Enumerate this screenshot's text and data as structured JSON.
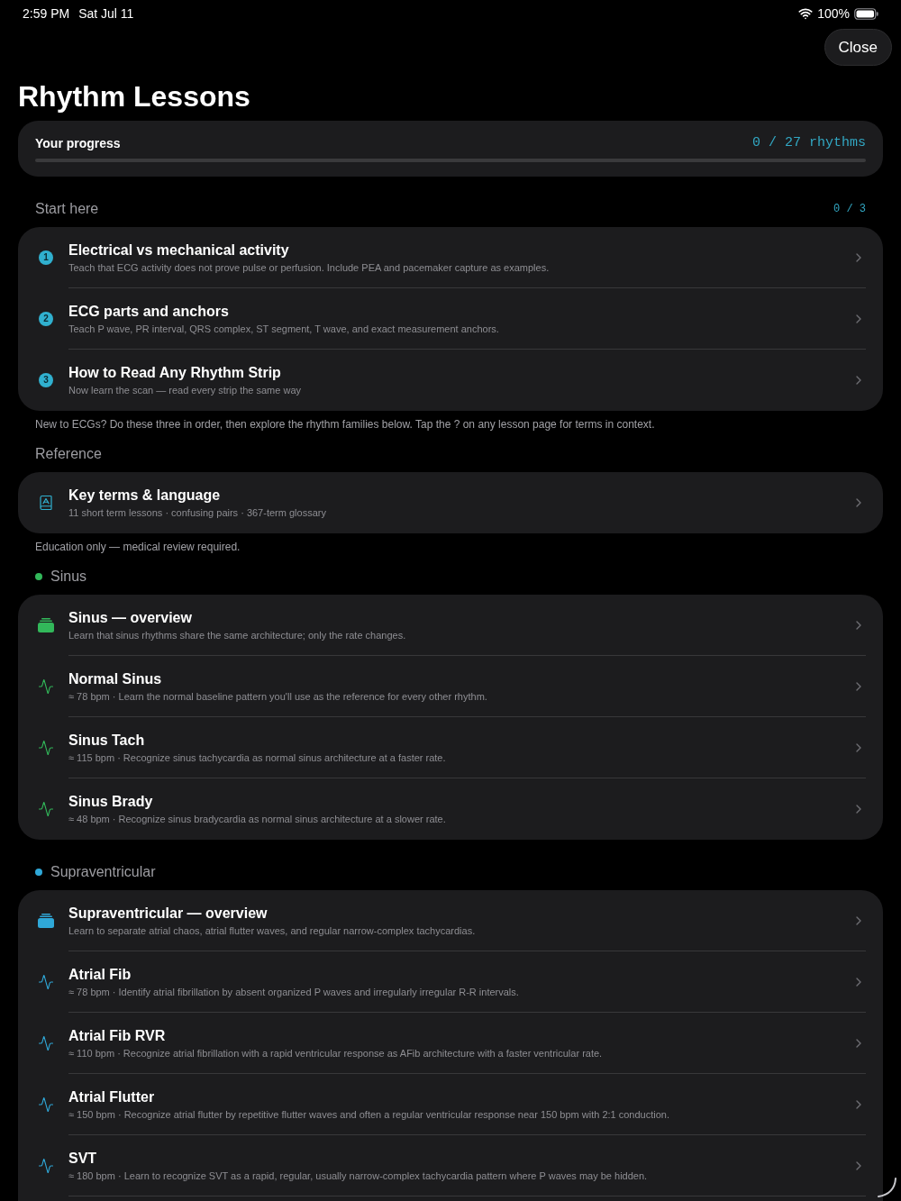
{
  "status_bar": {
    "time": "2:59 PM",
    "date": "Sat Jul 11",
    "battery": "100%"
  },
  "close_button": "Close",
  "title": "Rhythm Lessons",
  "progress": {
    "label": "Your progress",
    "count": "0 / 27 rhythms",
    "level": 0
  },
  "sections": [
    {
      "title": "Start here",
      "count": "0 / 3",
      "items": [
        {
          "kind": "number",
          "badge": "1",
          "title": "Electrical vs mechanical activity",
          "subtitle": "Teach that ECG activity does not prove pulse or perfusion. Include PEA and pacemaker capture as examples."
        },
        {
          "kind": "number",
          "badge": "2",
          "title": "ECG parts and anchors",
          "subtitle": "Teach P wave, PR interval, QRS complex, ST segment, T wave, and exact measurement anchors."
        },
        {
          "kind": "number",
          "badge": "3",
          "title": "How to Read Any Rhythm Strip",
          "subtitle": "Now learn the scan — read every strip the same way"
        }
      ],
      "footnote": "New to ECGs? Do these three in order, then explore the rhythm families below. Tap the ? on any lesson page for terms in context."
    },
    {
      "title": "Reference",
      "items": [
        {
          "kind": "book",
          "title": "Key terms & language",
          "subtitle": "11 short term lessons · confusing pairs · 367-term glossary"
        }
      ],
      "footnote": "Education only — medical review required."
    },
    {
      "title": "Sinus",
      "color": "#32b85a",
      "items": [
        {
          "kind": "overview",
          "title": "Sinus — overview",
          "subtitle": "Learn that sinus rhythms share the same architecture; only the rate changes."
        },
        {
          "kind": "rhythm",
          "title": "Normal Sinus",
          "subtitle": "≈ 78 bpm · Learn the normal baseline pattern you'll use as the reference for every other rhythm."
        },
        {
          "kind": "rhythm",
          "title": "Sinus Tach",
          "subtitle": "≈ 115 bpm · Recognize sinus tachycardia as normal sinus architecture at a faster rate."
        },
        {
          "kind": "rhythm",
          "title": "Sinus Brady",
          "subtitle": "≈ 48 bpm · Recognize sinus bradycardia as normal sinus architecture at a slower rate."
        }
      ]
    },
    {
      "title": "Supraventricular",
      "color": "#2fa8d8",
      "cut_off": true,
      "items": [
        {
          "kind": "overview",
          "title": "Supraventricular — overview",
          "subtitle": "Learn to separate atrial chaos, atrial flutter waves, and regular narrow-complex tachycardias."
        },
        {
          "kind": "rhythm",
          "title": "Atrial Fib",
          "subtitle": "≈ 78 bpm · Identify atrial fibrillation by absent organized P waves and irregularly irregular R-R intervals."
        },
        {
          "kind": "rhythm",
          "title": "Atrial Fib RVR",
          "subtitle": "≈ 110 bpm · Recognize atrial fibrillation with a rapid ventricular response as AFib architecture with a faster ventricular rate."
        },
        {
          "kind": "rhythm",
          "title": "Atrial Flutter",
          "subtitle": "≈ 150 bpm · Recognize atrial flutter by repetitive flutter waves and often a regular ventricular response near 150 bpm with 2:1 conduction."
        },
        {
          "kind": "rhythm",
          "title": "SVT",
          "subtitle": "≈ 180 bpm · Learn to recognize SVT as a rapid, regular, usually narrow-complex tachycardia pattern where P waves may be hidden."
        }
      ]
    }
  ]
}
